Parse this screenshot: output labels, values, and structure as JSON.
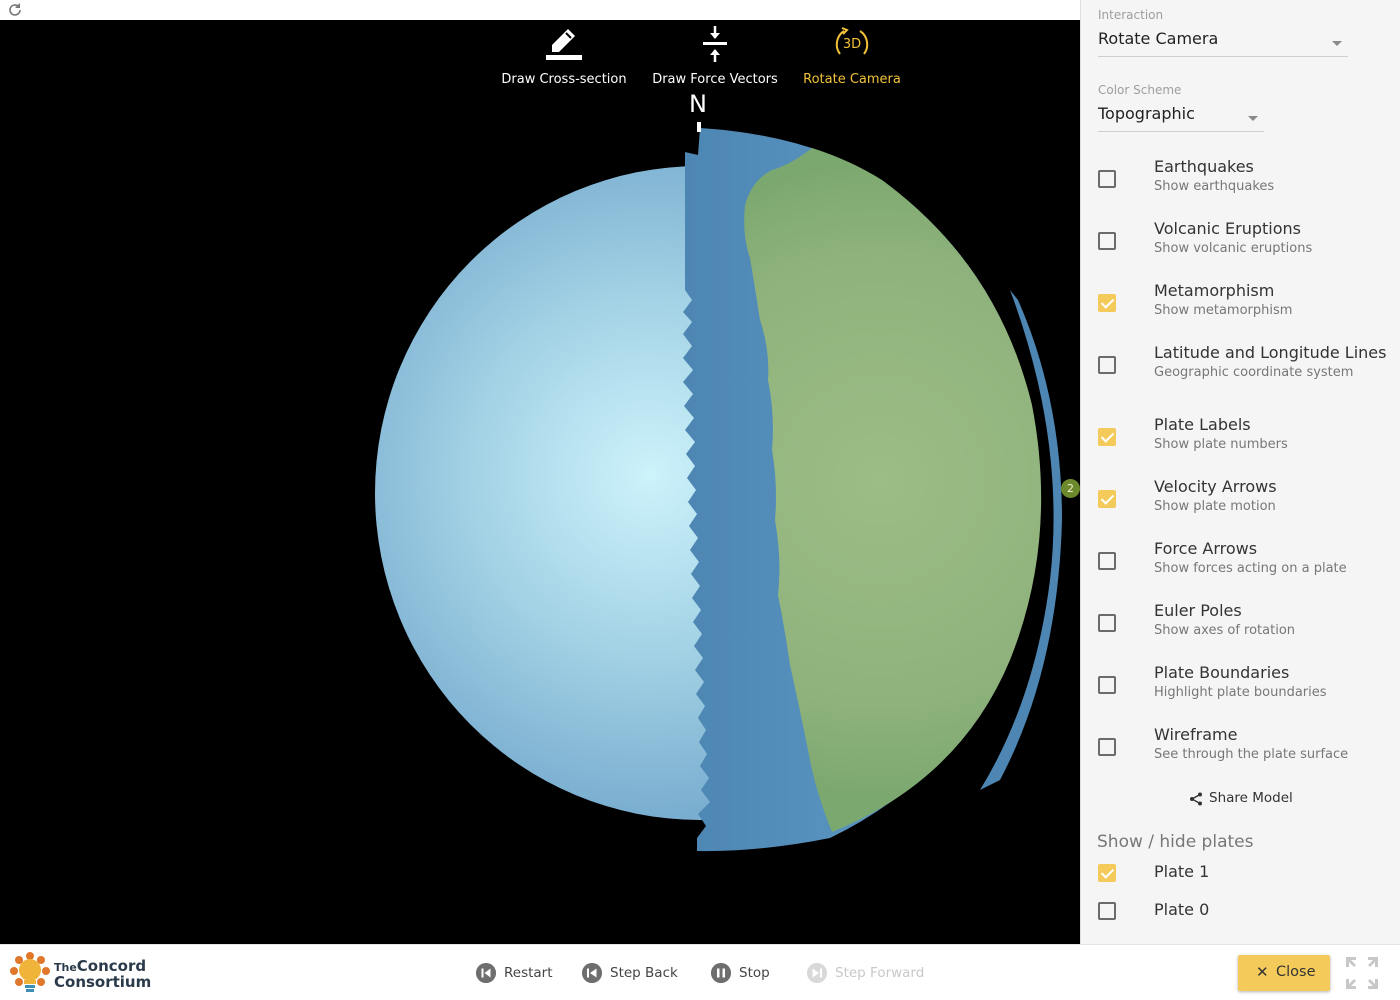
{
  "toolbar": {
    "cross_section": "Draw Cross-section",
    "force_vectors": "Draw Force Vectors",
    "rotate_camera": "Rotate Camera",
    "rotate_icon_text": "3D"
  },
  "globe": {
    "north_label": "N",
    "plate_marker": "2",
    "colors": {
      "ocean_light": "#cdf3fb",
      "ocean": "#87bcd6",
      "ocean_edge": "#4d86b2",
      "land": "#8fb27c",
      "active_tool": "#f1c23a"
    }
  },
  "panel": {
    "interaction": {
      "label": "Interaction",
      "value": "Rotate Camera"
    },
    "color_scheme": {
      "label": "Color Scheme",
      "value": "Topographic"
    },
    "options": [
      {
        "title": "Earthquakes",
        "subtitle": "Show earthquakes",
        "checked": false
      },
      {
        "title": "Volcanic Eruptions",
        "subtitle": "Show volcanic eruptions",
        "checked": false
      },
      {
        "title": "Metamorphism",
        "subtitle": "Show metamorphism",
        "checked": true
      },
      {
        "title": "Latitude and Longitude Lines",
        "subtitle": "Geographic coordinate system",
        "checked": false
      },
      {
        "title": "Plate Labels",
        "subtitle": "Show plate numbers",
        "checked": true
      },
      {
        "title": "Velocity Arrows",
        "subtitle": "Show plate motion",
        "checked": true
      },
      {
        "title": "Force Arrows",
        "subtitle": "Show forces acting on a plate",
        "checked": false
      },
      {
        "title": "Euler Poles",
        "subtitle": "Show axes of rotation",
        "checked": false
      },
      {
        "title": "Plate Boundaries",
        "subtitle": "Highlight plate boundaries",
        "checked": false
      },
      {
        "title": "Wireframe",
        "subtitle": "See through the plate surface",
        "checked": false
      }
    ],
    "share": "Share Model",
    "show_hide_title": "Show / hide plates",
    "plates": [
      {
        "name": "Plate 1",
        "checked": true
      },
      {
        "name": "Plate 0",
        "checked": false
      }
    ]
  },
  "bottom": {
    "logo_line1_small": "The",
    "logo_line1": "Concord",
    "logo_line2": "Consortium",
    "restart": "Restart",
    "step_back": "Step Back",
    "stop": "Stop",
    "step_forward": "Step Forward",
    "close": "Close"
  }
}
